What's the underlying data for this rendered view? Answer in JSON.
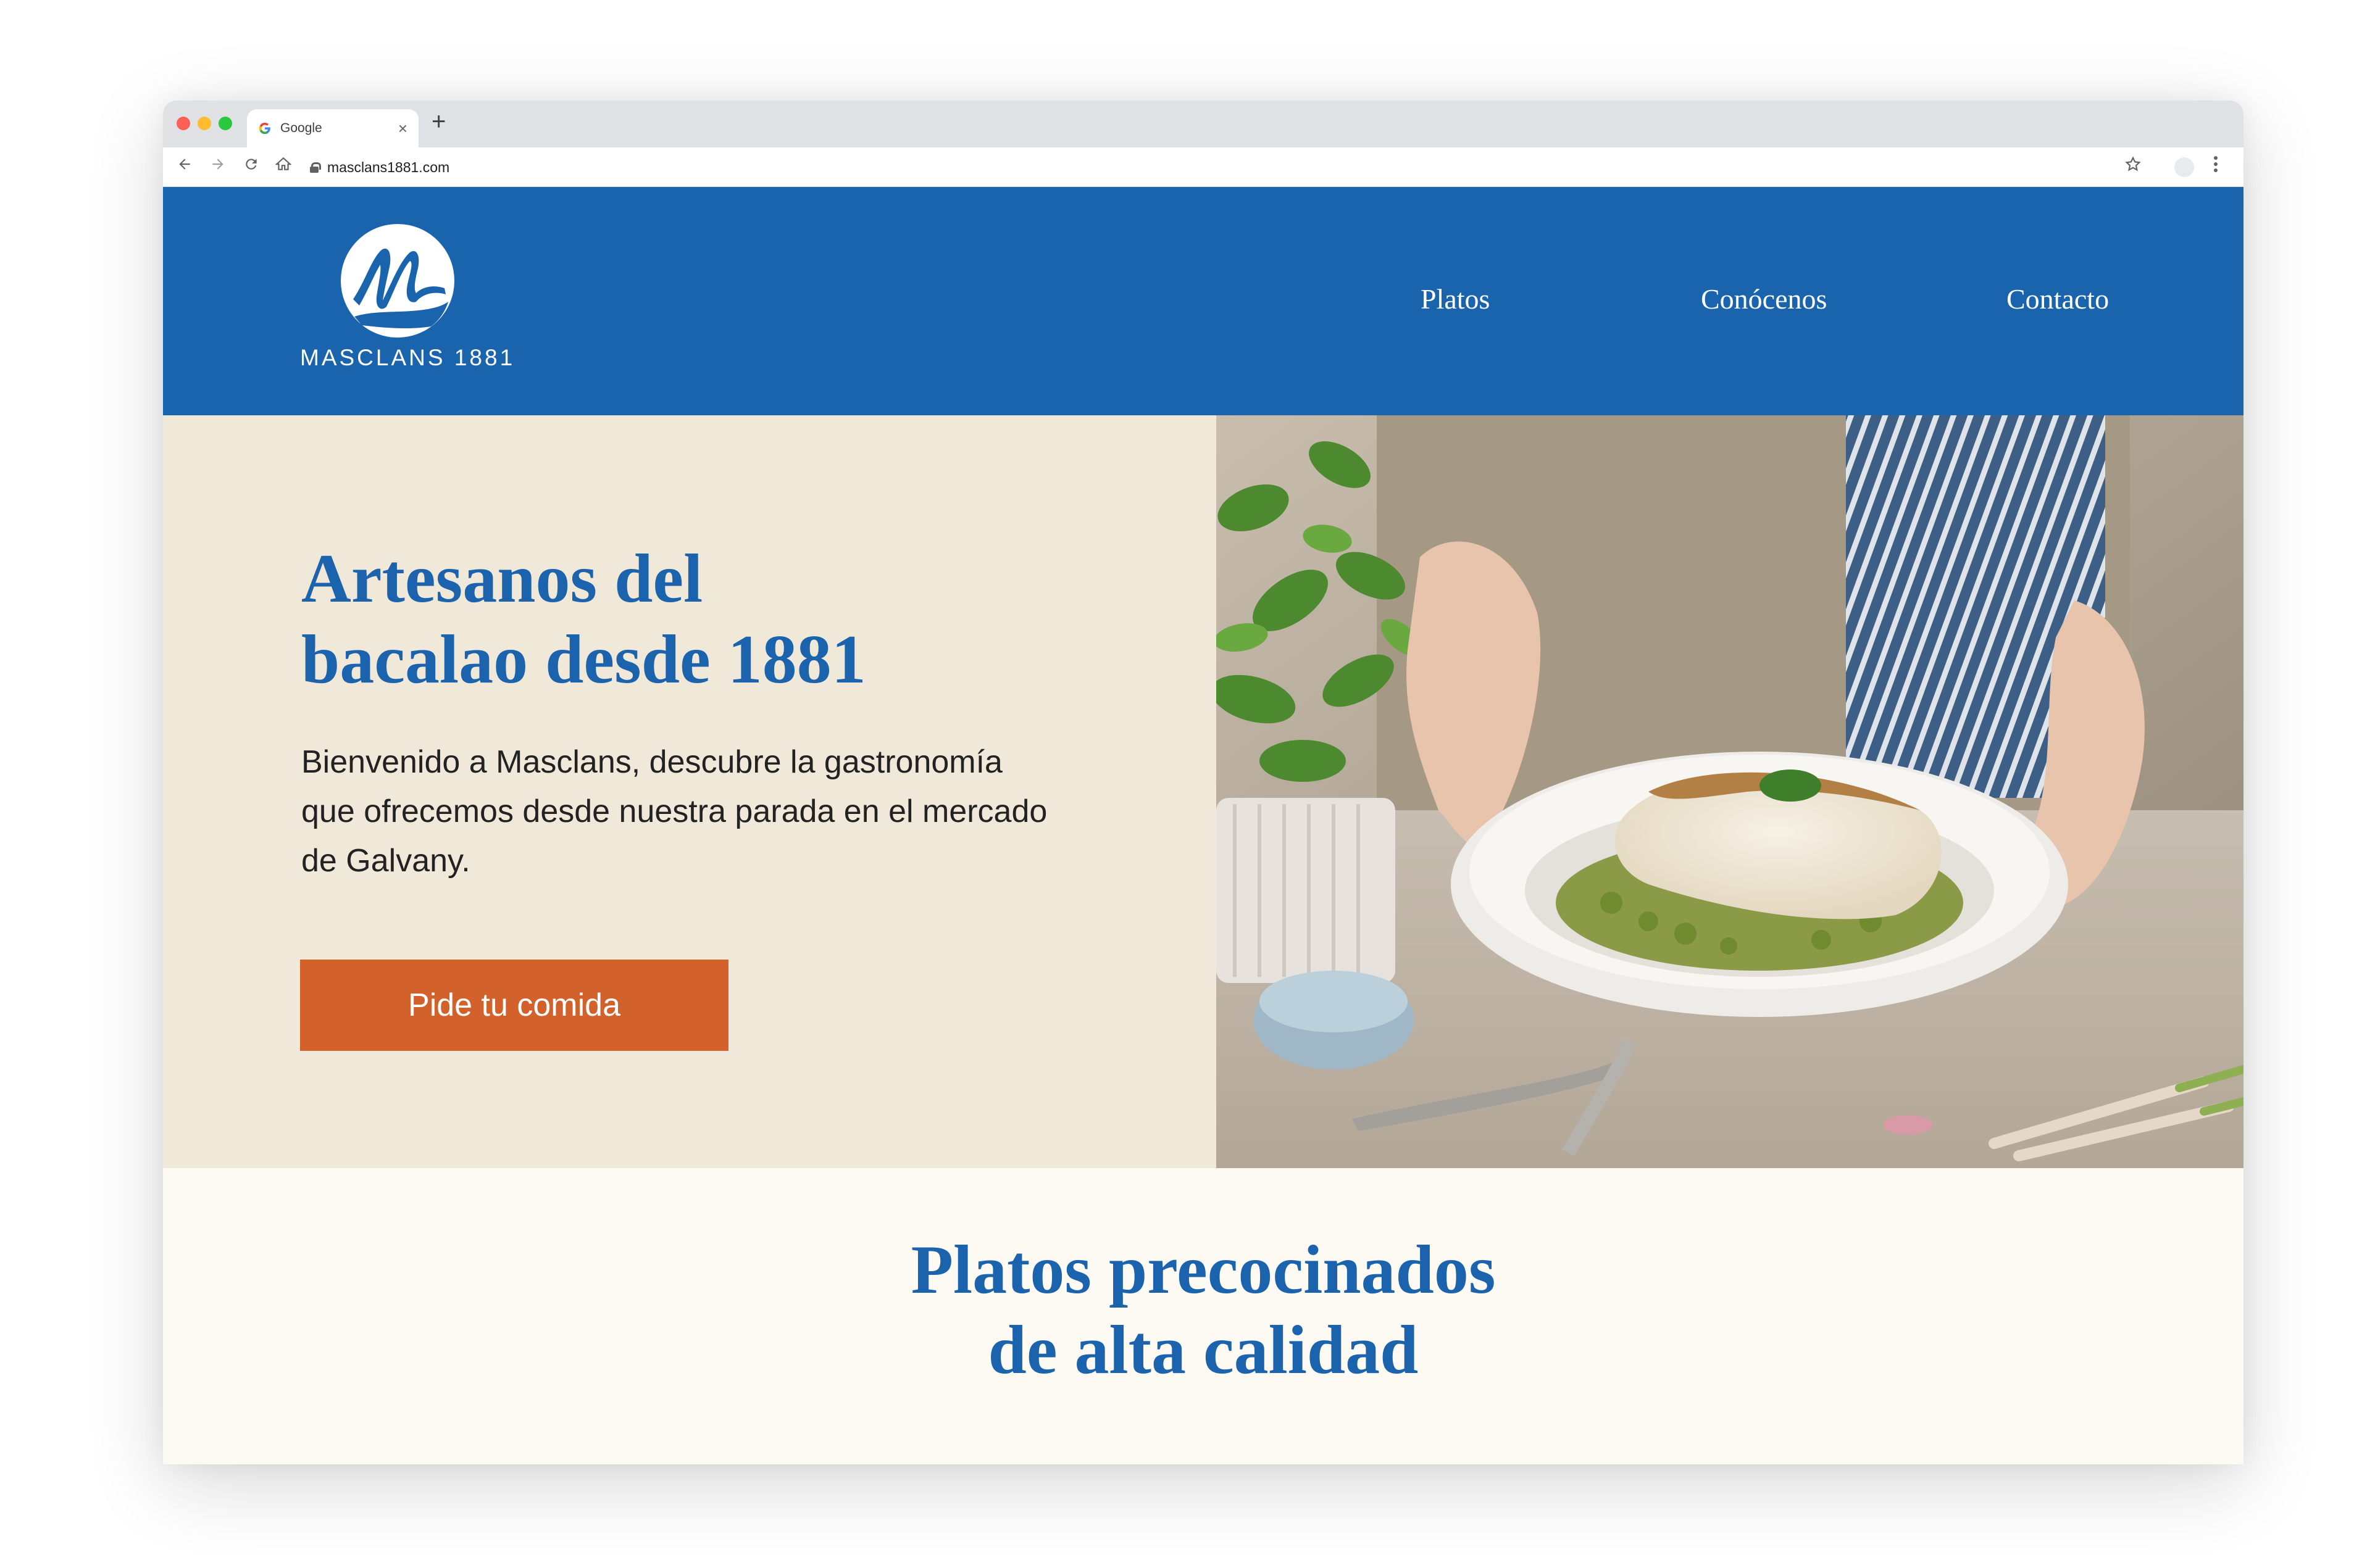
{
  "browser": {
    "tab_title": "Google",
    "tab_close": "×",
    "new_tab": "+",
    "url": "masclans1881.com"
  },
  "site": {
    "logo_text": "MASCLANS 1881",
    "nav": [
      "Platos",
      "Conócenos",
      "Contacto"
    ]
  },
  "hero": {
    "title": "Artesanos del\nbacalao desde 1881",
    "body": "Bienvenido a Masclans, descubre la gastronomía que ofrecemos desde nuestra parada en el mercado de Galvany.",
    "cta": "Pide tu comida"
  },
  "section": {
    "title": "Platos precocinados\nde alta calidad"
  },
  "colors": {
    "brand_blue": "#1a64ae",
    "cream": "#f0e8d8",
    "cta_orange": "#d3612c",
    "off_white": "#fdfaf3"
  },
  "icons": [
    "google-favicon-icon",
    "back-icon",
    "forward-icon",
    "reload-icon",
    "home-icon",
    "lock-icon",
    "star-icon",
    "profile-icon",
    "menu-dots-icon",
    "masclans-logo-icon"
  ]
}
